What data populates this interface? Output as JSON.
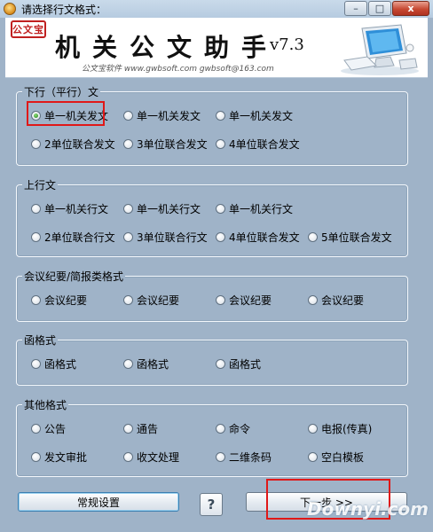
{
  "window": {
    "title": "请选择行文格式：",
    "controls": {
      "minimize": "–",
      "maximize": "□",
      "close": "x"
    }
  },
  "banner": {
    "seal_text": "公文宝",
    "app_title": "机关公文助手",
    "version": "v7.3",
    "subtitle": "公文宝软件 www.gwbsoft.com gwbsoft@163.com"
  },
  "groups": [
    {
      "title": "下行（平行）文",
      "rows": [
        [
          {
            "label": "单一机关发文",
            "checked": true
          },
          {
            "label": "单一机关发文"
          },
          {
            "label": "单一机关发文"
          }
        ],
        [
          {
            "label": "2单位联合发文"
          },
          {
            "label": "3单位联合发文"
          },
          {
            "label": "4单位联合发文"
          }
        ]
      ]
    },
    {
      "title": "上行文",
      "rows": [
        [
          {
            "label": "单一机关行文"
          },
          {
            "label": "单一机关行文"
          },
          {
            "label": "单一机关行文"
          }
        ],
        [
          {
            "label": "2单位联合行文"
          },
          {
            "label": "3单位联合行文"
          },
          {
            "label": "4单位联合发文"
          },
          {
            "label": "5单位联合发文"
          }
        ]
      ]
    },
    {
      "title": "会议纪要/简报类格式",
      "rows": [
        [
          {
            "label": "会议纪要"
          },
          {
            "label": "会议纪要"
          },
          {
            "label": "会议纪要"
          },
          {
            "label": "会议纪要"
          }
        ]
      ]
    },
    {
      "title": "函格式",
      "rows": [
        [
          {
            "label": "函格式"
          },
          {
            "label": "函格式"
          },
          {
            "label": "函格式"
          }
        ]
      ]
    },
    {
      "title": "其他格式",
      "rows": [
        [
          {
            "label": "公告"
          },
          {
            "label": "通告"
          },
          {
            "label": "命令"
          },
          {
            "label": "电报(传真)"
          }
        ],
        [
          {
            "label": "发文审批"
          },
          {
            "label": "收文处理"
          },
          {
            "label": "二维条码"
          },
          {
            "label": "空白模板"
          }
        ]
      ]
    }
  ],
  "buttons": {
    "settings": "常规设置",
    "help": "?",
    "next": "下一步 >>"
  },
  "watermark": "Downyi.com"
}
